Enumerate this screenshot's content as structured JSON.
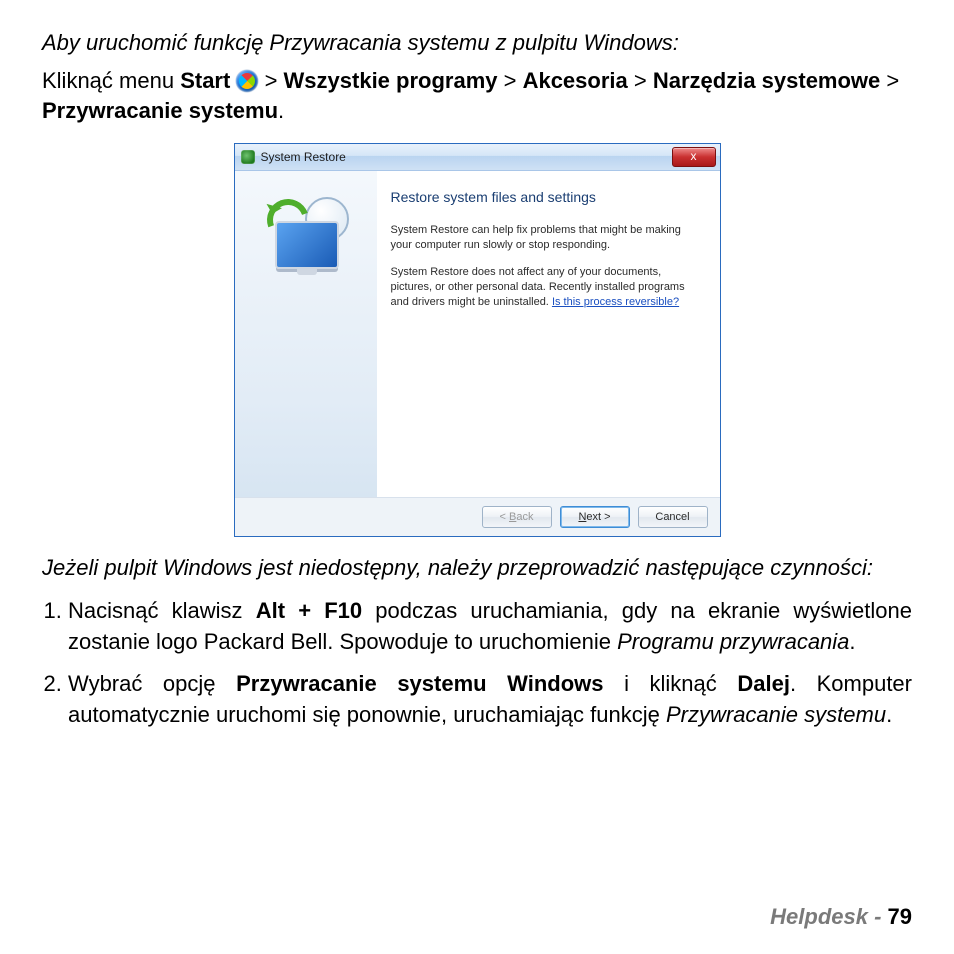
{
  "intro": "Aby uruchomić funkcję Przywracania systemu z pulpitu Windows:",
  "instruction": {
    "pre": "Kliknąć menu ",
    "start": "Start",
    "gt": " > ",
    "p1": "Wszystkie programy",
    "p2": "Akcesoria",
    "p3": "Narzędzia systemowe",
    "p4": "Przywracanie systemu",
    "dot": "."
  },
  "dialog": {
    "title": "System Restore",
    "close": "x",
    "heading": "Restore system files and settings",
    "para1": "System Restore can help fix problems that might be making your computer run slowly or stop responding.",
    "para2a": "System Restore does not affect any of your documents, pictures, or other personal data. Recently installed programs and drivers might be uninstalled. ",
    "link": "Is this process reversible?",
    "buttons": {
      "back_pre": "< ",
      "back_u": "B",
      "back_rest": "ack",
      "next_u": "N",
      "next_rest": "ext >",
      "cancel": "Cancel"
    }
  },
  "para2": "Jeżeli pulpit Windows jest niedostępny, należy przeprowadzić następujące czynności:",
  "step1": {
    "a": "Nacisnąć klawisz ",
    "key": "Alt + F10",
    "b": " podczas uruchamiania, gdy na ekranie wyświetlone zostanie logo Packard Bell. Spowoduje to uruchomienie ",
    "prog": "Programu przywracania",
    "dot": "."
  },
  "step2": {
    "a": "Wybrać opcję ",
    "opt": "Przywracanie systemu Windows",
    "b": " i kliknąć ",
    "btn": "Dalej",
    "c": ". Komputer automatycznie uruchomi się ponownie, uruchamiając funkcję ",
    "fn": "Przywracanie systemu",
    "dot": "."
  },
  "footer": {
    "section": "Helpdesk - ",
    "page": " 79"
  }
}
